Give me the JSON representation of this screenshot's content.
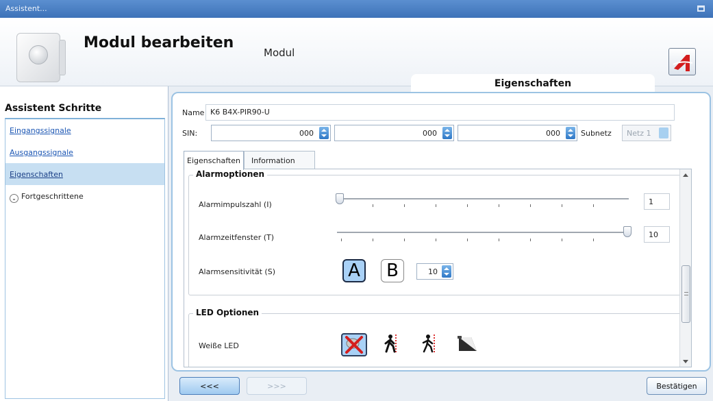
{
  "window": {
    "title": "Assistent..."
  },
  "header": {
    "title": "Modul bearbeiten",
    "subtitle": "Modul",
    "logo": "app-logo-icon"
  },
  "sidebar": {
    "heading": "Assistent Schritte",
    "items": [
      {
        "label": "Eingangssignale",
        "selected": false
      },
      {
        "label": "Ausgangssignale",
        "selected": false
      },
      {
        "label": "Eigenschaften",
        "selected": true
      },
      {
        "label": "Fortgeschrittene",
        "selected": false
      }
    ]
  },
  "main": {
    "section_tab": "Eigenschaften",
    "name_label": "Name",
    "name_value": "K6 B4X-PIR90-U",
    "sin_label": "SIN:",
    "sin_values": [
      "000",
      "000",
      "000"
    ],
    "subnet_label": "Subnetz",
    "subnet_value": "Netz 1",
    "tabs": [
      {
        "label": "Eigenschaften",
        "active": true
      },
      {
        "label": "Information",
        "active": false
      }
    ],
    "alarm": {
      "heading": "Alarmoptionen",
      "impulse_label": "Alarmimpulszahl (I)",
      "impulse_value": "1",
      "window_label": "Alarmzeitfenster (T)",
      "window_value": "10",
      "sensitivity_label": "Alarmsensitivität (S)",
      "mode_a": "A",
      "mode_b": "B",
      "selected_mode": "A",
      "sensitivity_value": "10"
    },
    "led": {
      "heading": "LED Optionen",
      "white_label": "Weiße LED",
      "icons": [
        "led-off-icon",
        "walking-person-icon",
        "walking-person-icon",
        "light-icon"
      ],
      "selected_index": 0
    }
  },
  "footer": {
    "back_label": "<<<",
    "next_label": ">>>",
    "confirm_label": "Bestätigen"
  },
  "colors": {
    "accent": "#3d72b8",
    "selection": "#c7dff2",
    "panel_border": "#9cc3e3"
  }
}
